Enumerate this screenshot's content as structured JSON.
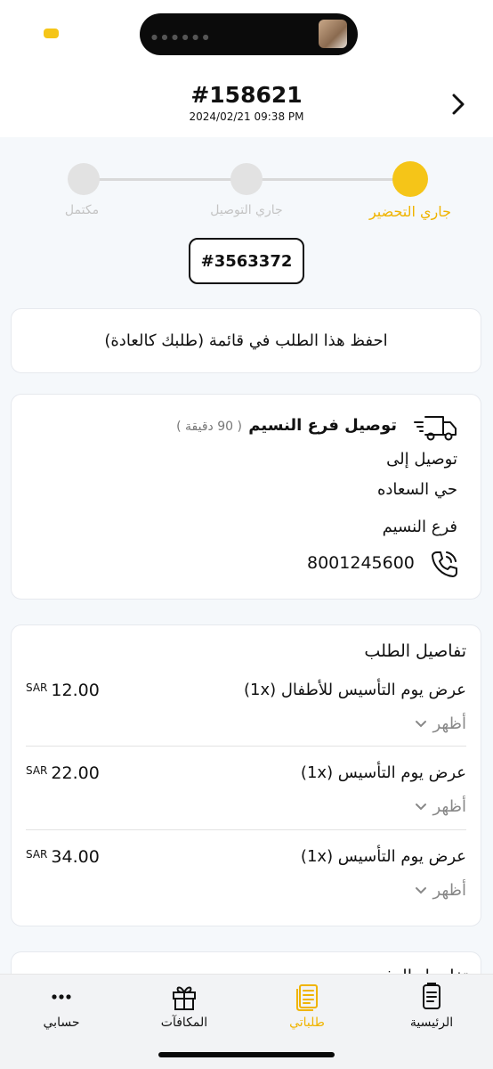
{
  "header": {
    "order_number": "#158621",
    "datetime": "2024/02/21 09:38 PM"
  },
  "stepper": {
    "steps": [
      {
        "label": "جاري التحضير",
        "state": "active"
      },
      {
        "label": "جاري التوصيل",
        "state": "pending"
      },
      {
        "label": "مكتمل",
        "state": "pending"
      }
    ]
  },
  "ticket_number": "#3563372",
  "save_order_text": "احفظ هذا الطلب في قائمة (طلبك كالعادة)",
  "delivery": {
    "branch_title": "توصيل فرع النسيم",
    "eta": "( 90 دقيقة )",
    "deliver_to_label": "توصيل إلى",
    "district": "حي السعاده",
    "branch": "فرع النسيم",
    "phone": "8001245600"
  },
  "order_details": {
    "title": "تفاصيل الطلب",
    "show_label": "أظهر",
    "currency": "SAR",
    "items": [
      {
        "name": "عرض يوم التأسيس للأطفال (1x)",
        "price": "12.00"
      },
      {
        "name": "عرض يوم التأسيس (1x)",
        "price": "22.00"
      },
      {
        "name": "عرض يوم التأسيس (1x)",
        "price": "34.00"
      }
    ]
  },
  "next_section_title": "تفاصيل الدفع",
  "bottom_nav": {
    "items": [
      {
        "label": "الرئيسية",
        "icon": "home-receipt-icon"
      },
      {
        "label": "طلباتي",
        "icon": "orders-icon",
        "active": true
      },
      {
        "label": "المكافآت",
        "icon": "gift-icon"
      },
      {
        "label": "حسابي",
        "icon": "more-dots-icon"
      }
    ]
  },
  "colors": {
    "accent": "#f5c518",
    "accent_text": "#f0b400",
    "inactive": "#e2e2e2"
  }
}
